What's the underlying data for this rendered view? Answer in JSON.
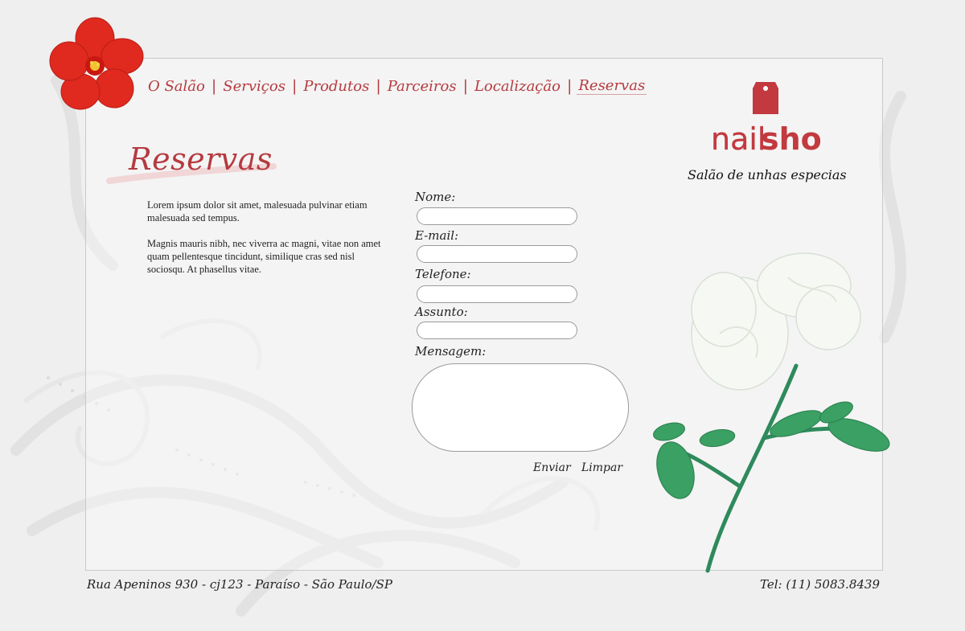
{
  "nav": {
    "items": [
      {
        "label": "O Salão"
      },
      {
        "label": "Serviços"
      },
      {
        "label": "Produtos"
      },
      {
        "label": "Parceiros"
      },
      {
        "label": "Localização"
      },
      {
        "label": "Reservas"
      }
    ],
    "separator": "|",
    "active": "Reservas"
  },
  "page": {
    "title": "Reservas",
    "intro_p1": "Lorem ipsum dolor sit amet, malesuada pulvinar etiam malesuada sed tempus.",
    "intro_p2": " Magnis mauris nibh, nec viverra ac magni, vitae non amet quam pellentesque tincidunt, similique cras sed nisl sociosqu. At phasellus vitae."
  },
  "form": {
    "name_label": "Nome:",
    "email_label": "E-mail:",
    "phone_label": "Telefone:",
    "subject_label": "Assunto:",
    "message_label": "Mensagem:",
    "name_value": "",
    "email_value": "",
    "phone_value": "",
    "subject_value": "",
    "message_value": "",
    "send_label": "Enviar",
    "clear_label": "Limpar"
  },
  "brand": {
    "logo_part1": "nail",
    "logo_part2": "shop",
    "tagline": "Salão de unhas especias"
  },
  "footer": {
    "address": "Rua Apeninos 930 - cj123 - Paraíso - São Paulo/SP",
    "phone": "Tel: (11) 5083.8439"
  },
  "colors": {
    "accent": "#b53a3f",
    "background": "#efefef"
  }
}
